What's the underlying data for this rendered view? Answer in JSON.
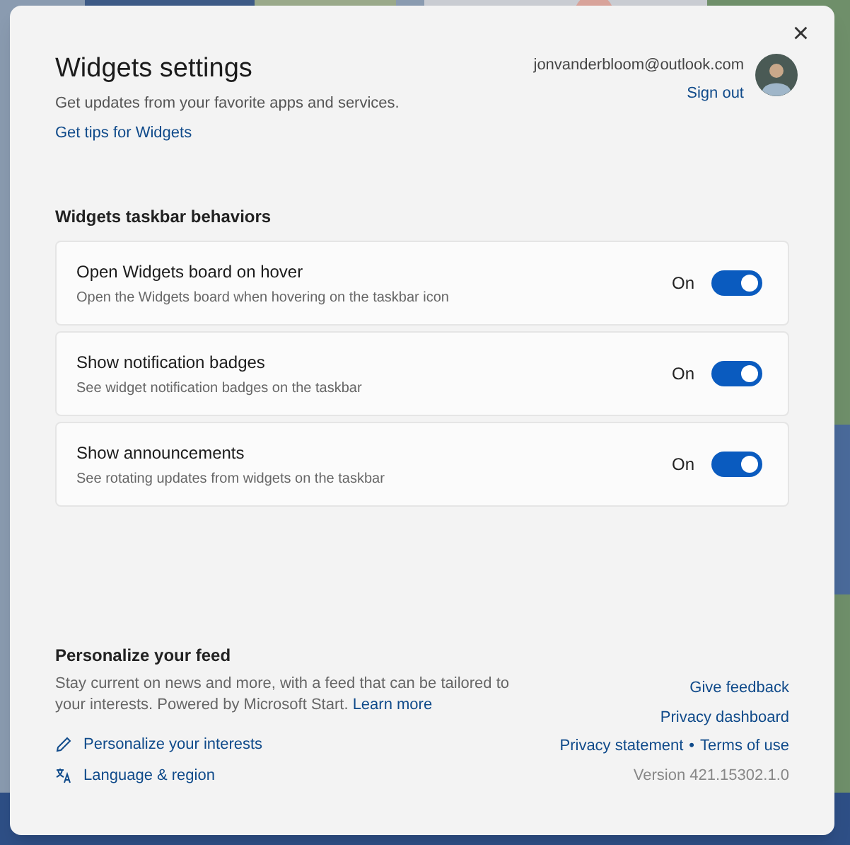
{
  "dialog": {
    "title": "Widgets settings",
    "subtitle": "Get updates from your favorite apps and services.",
    "tips_link": "Get tips for Widgets",
    "close": "×"
  },
  "account": {
    "email": "jonvanderbloom@outlook.com",
    "sign_out": "Sign out"
  },
  "section_title": "Widgets taskbar behaviors",
  "settings": [
    {
      "title": "Open Widgets board on hover",
      "description": "Open the Widgets board when hovering on the taskbar icon",
      "state_label": "On",
      "on": true
    },
    {
      "title": "Show notification badges",
      "description": "See widget notification badges on the taskbar",
      "state_label": "On",
      "on": true
    },
    {
      "title": "Show announcements",
      "description": "See rotating updates from widgets on the taskbar",
      "state_label": "On",
      "on": true
    }
  ],
  "feed": {
    "title": "Personalize your feed",
    "description": "Stay current on news and more, with a feed that can be tailored to your interests. Powered by Microsoft Start.",
    "learn_more": "Learn more",
    "links": [
      {
        "kind": "pencil",
        "label": "Personalize your interests"
      },
      {
        "kind": "language",
        "label": "Language & region"
      }
    ]
  },
  "footer_links": [
    {
      "label": "Give feedback"
    },
    {
      "label": "Privacy dashboard"
    }
  ],
  "legal": {
    "privacy": "Privacy statement",
    "separator": "•",
    "terms": "Terms of use"
  },
  "version": "Version 421.15302.1.0"
}
